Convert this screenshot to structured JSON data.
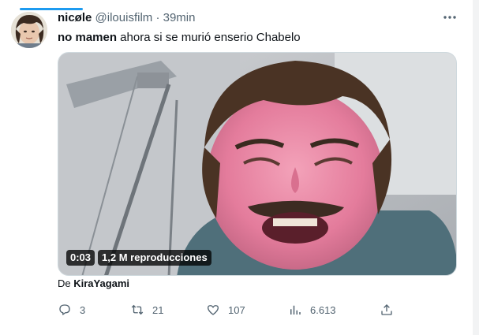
{
  "tweet": {
    "display_name": "nicøle",
    "handle": "@ilouisfilm",
    "separator": "·",
    "time": "39min",
    "text_bold": "no mamen",
    "text_rest": " ahora si se murió enserio Chabelo",
    "more_icon": "more-horizontal-icon"
  },
  "media": {
    "duration": "0:03",
    "views": "1,2 M reproducciones"
  },
  "attribution": {
    "prefix": "De ",
    "source": "KiraYagami"
  },
  "actions": {
    "reply_count": "3",
    "retweet_count": "21",
    "like_count": "107",
    "view_count": "6.613",
    "icons": [
      "reply-icon",
      "retweet-icon",
      "like-icon",
      "views-icon",
      "share-icon"
    ]
  },
  "colors": {
    "accent": "#1d9bf0",
    "secondary_text": "#536471",
    "primary_text": "#0f1419"
  }
}
